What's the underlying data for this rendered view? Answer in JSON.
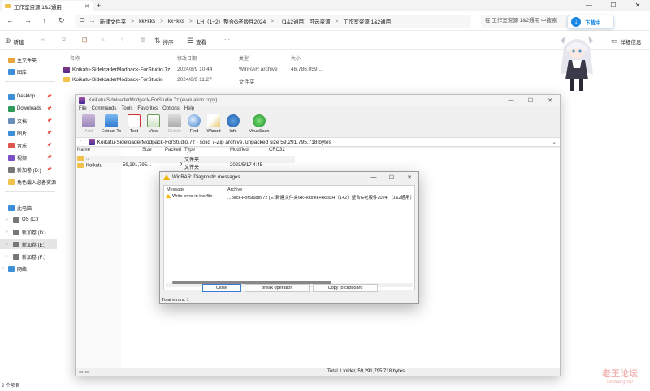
{
  "explorer": {
    "tab_title": "工作室资源 1&2通用",
    "tab_close": "✕",
    "new_tab": "+",
    "window_controls": [
      "—",
      "☐",
      "✕"
    ],
    "nav": {
      "back": "←",
      "forward": "→",
      "up": "↑",
      "refresh": "↻",
      "monitor": "🖵",
      "more": "···"
    },
    "breadcrumbs": [
      "新建文件夹",
      "kk+kks",
      "kk+kks",
      "LH（1+2）整合G老版件2024",
      "（1&2通用）可选资源",
      "工作室资源 1&2通用"
    ],
    "crumb_sep": ">",
    "search_placeholder": "在 工作室资源 1&2通用 中搜索",
    "download_label": "下载中...",
    "commands": {
      "new": "新建",
      "sort": "排序",
      "view": "查看",
      "more": "···",
      "details": "详细信息"
    },
    "columns": {
      "name": "名称",
      "modified": "修改日期",
      "type": "类型",
      "size": "大小"
    },
    "files": [
      {
        "name": "Koikatu-SideloaderModpack-ForStudio.7z",
        "modified": "2024/8/9 10:44",
        "type": "WinRAR archive",
        "size": "46,786,059 ..."
      },
      {
        "name": "Koikatu-SideloaderModpack-ForStudio",
        "modified": "2024/8/9 11:27",
        "type": "文件夹",
        "size": ""
      }
    ],
    "sidebar": {
      "top": [
        {
          "label": "主文件夹"
        },
        {
          "label": "图库"
        }
      ],
      "quick": [
        {
          "label": "Desktop",
          "pin": "📌"
        },
        {
          "label": "Downloads",
          "pin": "📌"
        },
        {
          "label": "文档",
          "pin": "📌"
        },
        {
          "label": "图片",
          "pin": "📌"
        },
        {
          "label": "音乐",
          "pin": "📌"
        },
        {
          "label": "视频",
          "pin": "📌"
        },
        {
          "label": "新加卷 (D:)",
          "pin": "📌"
        },
        {
          "label": "角色载入必备资源",
          "pin": ""
        }
      ],
      "drives": [
        {
          "label": "此电脑"
        },
        {
          "label": "OS (C:)"
        },
        {
          "label": "新加卷 (D:)"
        },
        {
          "label": "新加卷 (E:)"
        },
        {
          "label": "新加卷 (F:)"
        },
        {
          "label": "网络"
        }
      ]
    },
    "status": "2 个项目"
  },
  "winrar": {
    "title": "Koikatu-SideloaderModpack-ForStudio.7z (evaluation copy)",
    "window_controls": [
      "—",
      "☐",
      "✕"
    ],
    "menu": [
      "File",
      "Commands",
      "Tools",
      "Favorites",
      "Options",
      "Help"
    ],
    "toolbar": [
      "Add",
      "Extract To",
      "Test",
      "View",
      "Delete",
      "Find",
      "Wizard",
      "Info",
      "VirusScan"
    ],
    "up_arrow": "↑",
    "path_text": "Koikatu-SideloaderModpack-ForStudio.7z - solid 7-Zip archive, unpacked size 59,291,795,718 bytes",
    "path_dropdown": "⌄",
    "columns": {
      "name": "Name",
      "size": "Size",
      "packed": "Packed",
      "type": "Type",
      "modified": "Modified",
      "crc": "CRC32"
    },
    "rows": [
      {
        "name": "..",
        "size": "",
        "packed": "",
        "type": "文件夹",
        "modified": "",
        "crc": ""
      },
      {
        "name": "Koikatu",
        "size": "59,291,795...",
        "packed": "?",
        "type": "文件夹",
        "modified": "2023/5/17 4:45",
        "crc": ""
      }
    ],
    "status_total": "Total 1 folder, 59,291,795,718 bytes"
  },
  "dialog": {
    "title": "WinRAR: Diagnostic messages",
    "window_controls": [
      "—",
      "☐",
      "✕"
    ],
    "columns": {
      "message": "Message",
      "archive": "Archive"
    },
    "message": "Write error in the file",
    "archive": "...pack-ForStudio.7z (E:\\新建文件夹\\kk+kks\\kk+kks\\LH（1+2）整合G老版件2024\\（1&2通用）可选资源",
    "buttons": {
      "close": "Close",
      "break": "Break operation",
      "copy": "Copy to clipboard"
    },
    "total_errors": "Total errors: 1"
  },
  "watermark": {
    "line1": "老王论坛",
    "line2": "laowang.vip"
  },
  "colors": {
    "accent": "#1b87e5",
    "folder": "#f0c14b",
    "warning": "#f0b400",
    "winrar": "#6a2f8f"
  }
}
